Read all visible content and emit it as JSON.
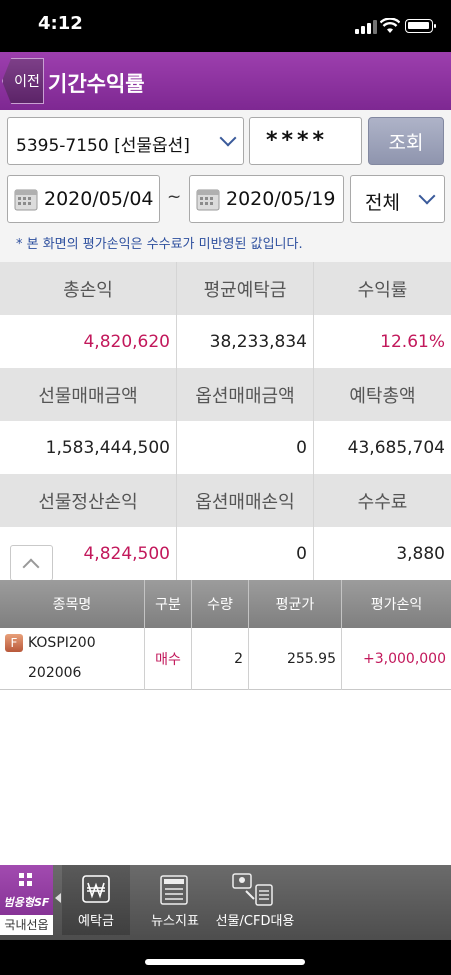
{
  "status": {
    "time": "4:12"
  },
  "header": {
    "back_label": "이전",
    "title": "기간수익률"
  },
  "controls": {
    "account": "5395-7150 [선물옵션]",
    "password_mask": "****",
    "query_label": "조회",
    "start_date": "2020/05/04",
    "date_sep": "~",
    "end_date": "2020/05/19",
    "filter": "전체",
    "note": "* 본 화면의 평가손익은 수수료가 미반영된 값입니다."
  },
  "summary": {
    "rows": [
      {
        "headers": [
          "총손익",
          "평균예탁금",
          "수익률"
        ],
        "values": [
          "4,820,620",
          "38,233,834",
          "12.61%"
        ]
      },
      {
        "headers": [
          "선물매매금액",
          "옵션매매금액",
          "예탁총액"
        ],
        "values": [
          "1,583,444,500",
          "0",
          "43,685,704"
        ]
      },
      {
        "headers": [
          "선물정산손익",
          "옵션매매손익",
          "수수료"
        ],
        "values": [
          "4,824,500",
          "0",
          "3,880"
        ]
      }
    ]
  },
  "positions": {
    "columns": [
      "종목명",
      "구분",
      "수량",
      "평균가",
      "평가손익"
    ],
    "rows": [
      {
        "badge": "F",
        "name": "KOSPI200",
        "code": "202006",
        "side": "매수",
        "qty": "2",
        "avg_price": "255.95",
        "pnl": "+3,000,000"
      }
    ]
  },
  "tabbar": {
    "brand_line1": "범용형SF",
    "brand_line2": "국내선옵",
    "tabs": [
      {
        "label": "예탁금",
        "icon": "won-icon"
      },
      {
        "label": "뉴스지표",
        "icon": "news-icon"
      },
      {
        "label": "선물/CFD대용",
        "icon": "document-icon"
      }
    ]
  },
  "colors": {
    "header": "#8e3aa3",
    "accent_red": "#c2185b",
    "note_blue": "#2d4f9e"
  }
}
